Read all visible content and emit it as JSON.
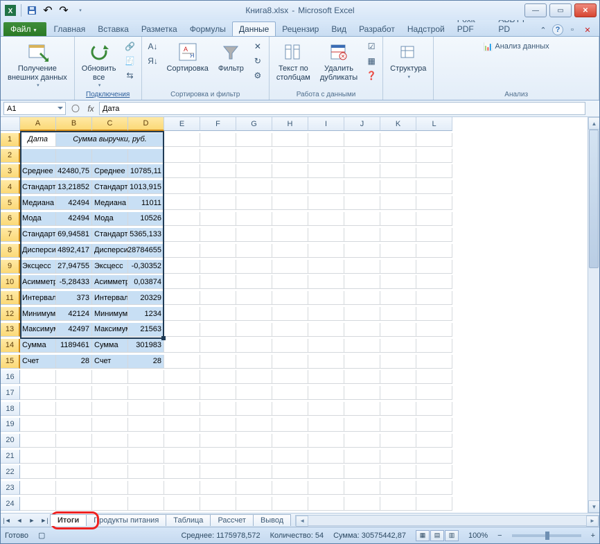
{
  "title": {
    "doc": "Книга8.xlsx",
    "app": "Microsoft Excel",
    "sep": "-"
  },
  "tabs": {
    "file": "Файл",
    "items": [
      "Главная",
      "Вставка",
      "Разметка",
      "Формулы",
      "Данные",
      "Рецензир",
      "Вид",
      "Разработ",
      "Надстрой",
      "Foxit PDF",
      "ABBYY PD"
    ],
    "active_index": 4
  },
  "ribbon": {
    "g1": {
      "btn": "Получение\nвнешних данных",
      "label": ""
    },
    "g2": {
      "btn": "Обновить\nвсе",
      "label": "Подключения"
    },
    "g3": {
      "sort": "Сортировка",
      "filter": "Фильтр",
      "label": "Сортировка и фильтр"
    },
    "g4": {
      "t2c": "Текст по\nстолбцам",
      "dedup": "Удалить\nдубликаты",
      "label": "Работа с данными"
    },
    "g5": {
      "btn": "Структура",
      "label": ""
    },
    "g6": {
      "btn": "Анализ данных",
      "label": "Анализ"
    }
  },
  "fx": {
    "name": "A1",
    "value": "Дата",
    "fx": "fx"
  },
  "cols": [
    "",
    "A",
    "B",
    "C",
    "D",
    "E",
    "F",
    "G",
    "H",
    "I",
    "J",
    "K",
    "L"
  ],
  "data_header": {
    "a": "Дата",
    "b": "Сумма выручки, руб."
  },
  "rows": [
    {
      "a": "Среднее",
      "b": "42480,75",
      "c": "Среднее",
      "d": "10785,11"
    },
    {
      "a": "Стандартн",
      "b": "13,21852",
      "c": "Стандартн",
      "d": "1013,915"
    },
    {
      "a": "Медиана",
      "b": "42494",
      "c": "Медиана",
      "d": "11011"
    },
    {
      "a": "Мода",
      "b": "42494",
      "c": "Мода",
      "d": "10526"
    },
    {
      "a": "Стандартн",
      "b": "69,94581",
      "c": "Стандартн",
      "d": "5365,133"
    },
    {
      "a": "Дисперси",
      "b": "4892,417",
      "c": "Дисперси",
      "d": "28784655"
    },
    {
      "a": "Эксцесс",
      "b": "27,94755",
      "c": "Эксцесс",
      "d": "-0,30352"
    },
    {
      "a": "Асимметр",
      "b": "-5,28433",
      "c": "Асимметр",
      "d": "0,03874"
    },
    {
      "a": "Интервал",
      "b": "373",
      "c": "Интервал",
      "d": "20329"
    },
    {
      "a": "Минимум",
      "b": "42124",
      "c": "Минимум",
      "d": "1234"
    },
    {
      "a": "Максимум",
      "b": "42497",
      "c": "Максимум",
      "d": "21563"
    },
    {
      "a": "Сумма",
      "b": "1189461",
      "c": "Сумма",
      "d": "301983"
    },
    {
      "a": "Счет",
      "b": "28",
      "c": "Счет",
      "d": "28"
    }
  ],
  "sheets": [
    "Итоги",
    "Продукты питания",
    "Таблица",
    "Рассчет",
    "Вывод"
  ],
  "status": {
    "ready": "Готово",
    "avg": "Среднее: 1175978,572",
    "count": "Количество: 54",
    "sum": "Сумма: 30575442,87",
    "zoom": "100%"
  }
}
